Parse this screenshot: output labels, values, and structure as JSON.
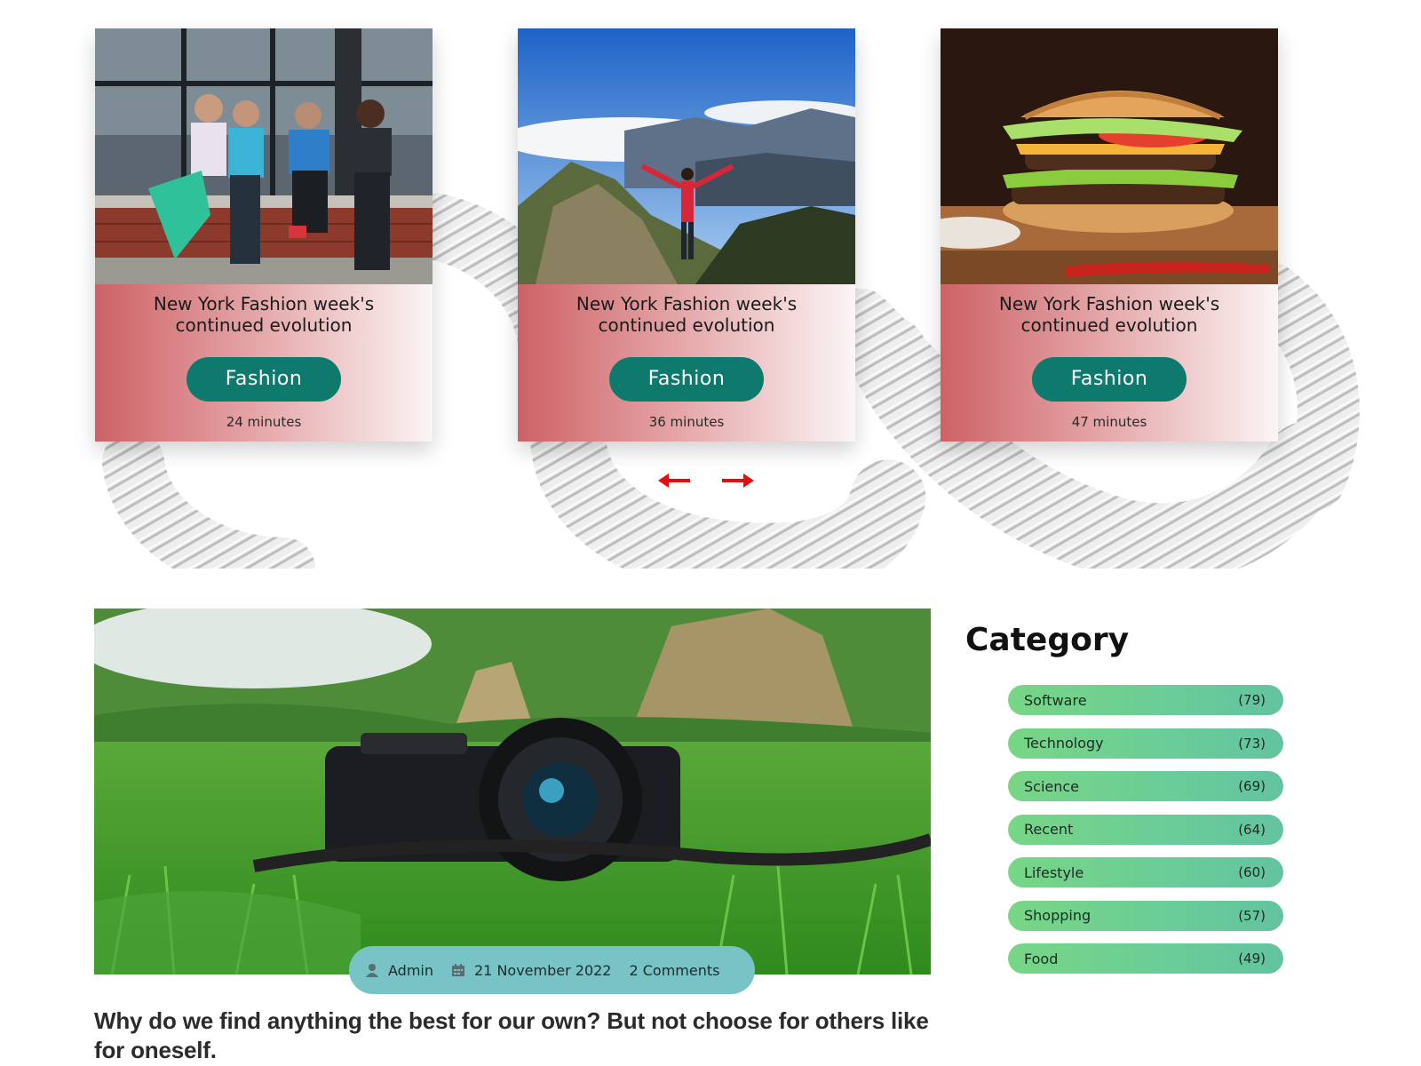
{
  "cards": [
    {
      "title": "New York Fashion week's continued evolution",
      "tag": "Fashion",
      "time": "24 minutes",
      "image": "friends-sitting-photo"
    },
    {
      "title": "New York Fashion week's continued evolution",
      "tag": "Fashion",
      "time": "36 minutes",
      "image": "mountain-hiker-photo"
    },
    {
      "title": "New York Fashion week's continued evolution",
      "tag": "Fashion",
      "time": "47 minutes",
      "image": "burger-photo"
    }
  ],
  "carousel": {
    "prev_icon": "arrow-left-icon",
    "next_icon": "arrow-right-icon",
    "arrow_color": "#e01010"
  },
  "post": {
    "image": "camera-in-grass-photo",
    "author": "Admin",
    "date": "21 November 2022",
    "comments": "2 Comments",
    "title": "Why do we find anything the best for our own? But not choose for others like for oneself."
  },
  "category": {
    "heading": "Category",
    "items": [
      {
        "label": "Software",
        "count": "(79)"
      },
      {
        "label": "Technology",
        "count": "(73)"
      },
      {
        "label": "Science",
        "count": "(69)"
      },
      {
        "label": "Recent",
        "count": "(64)"
      },
      {
        "label": "Lifestyle",
        "count": "(60)"
      },
      {
        "label": "Shopping",
        "count": "(57)"
      },
      {
        "label": "Food",
        "count": "(49)"
      }
    ]
  },
  "colors": {
    "tag_bg": "#0e7a6e",
    "meta_pill": "#77c3c6",
    "category_pill": "#6bcd97",
    "card_gradient_start": "#cd6266"
  }
}
